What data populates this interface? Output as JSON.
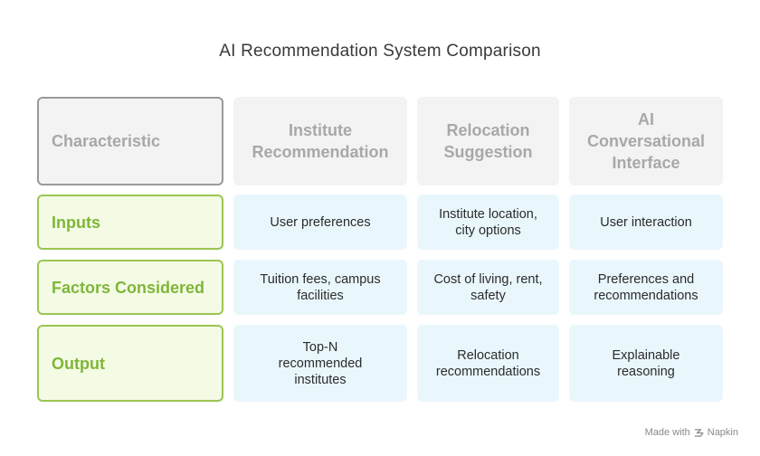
{
  "title": "AI Recommendation System Comparison",
  "headers": [
    "Characteristic",
    "Institute\nRecommendation",
    "Relocation\nSuggestion",
    "AI\nConversational\nInterface"
  ],
  "rows": [
    {
      "label": "Inputs",
      "cells": [
        "User preferences",
        "Institute location,\ncity options",
        "User interaction"
      ]
    },
    {
      "label": "Factors Considered",
      "cells": [
        "Tuition fees, campus\nfacilities",
        "Cost of living, rent,\nsafety",
        "Preferences and\nrecommendations"
      ]
    },
    {
      "label": "Output",
      "cells": [
        "Top-N\nrecommended\ninstitutes",
        "Relocation\nrecommendations",
        "Explainable\nreasoning"
      ]
    }
  ],
  "footer": {
    "text": "Made with",
    "brand": "Napkin"
  },
  "colors": {
    "header_bg": "#f3f3f3",
    "label_border": "#9bc554",
    "label_text": "#7fb63a",
    "data_bg": "#e9f7fd"
  }
}
